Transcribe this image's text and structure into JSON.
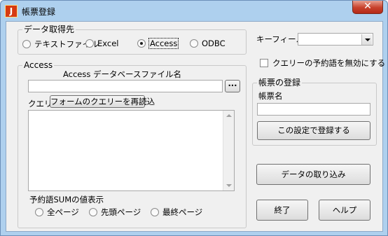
{
  "window": {
    "title": "帳票登録",
    "icon_letter": "J",
    "close_glyph": "✕"
  },
  "source_group": {
    "label": "データ取得先",
    "options": [
      {
        "label": "テキストファイル",
        "selected": false
      },
      {
        "label": "Excel",
        "selected": false
      },
      {
        "label": "Access",
        "selected": true
      },
      {
        "label": "ODBC",
        "selected": false
      }
    ]
  },
  "access_group": {
    "label": "Access",
    "db_file_label": "Access データベースファイル名",
    "db_file_value": "",
    "browse_label": "···",
    "query_label": "クエリー",
    "reload_button": "フォームのクエリーを再読込",
    "query_text": ""
  },
  "reserved_sum": {
    "label": "予約語SUMの値表示",
    "options": [
      {
        "label": "全ページ",
        "selected": false
      },
      {
        "label": "先頭ページ",
        "selected": false
      },
      {
        "label": "最終ページ",
        "selected": false
      }
    ]
  },
  "key_field": {
    "label": "キーフィールド",
    "value": ""
  },
  "disable_reserved_checkbox": {
    "label": "クエリーの予約語を無効にする",
    "checked": false
  },
  "register_group": {
    "label": "帳票の登録",
    "name_label": "帳票名",
    "name_value": "",
    "register_button": "この設定で登録する"
  },
  "buttons": {
    "import": "データの取り込み",
    "exit": "終了",
    "help": "ヘルプ"
  },
  "colors": {
    "title_bar": "#aed0ee",
    "close_button": "#c7412c",
    "client_bg": "#f0f0f0"
  },
  "icons": {
    "app": "app-j-icon",
    "close": "close-icon",
    "dropdown": "chevron-down-icon"
  }
}
